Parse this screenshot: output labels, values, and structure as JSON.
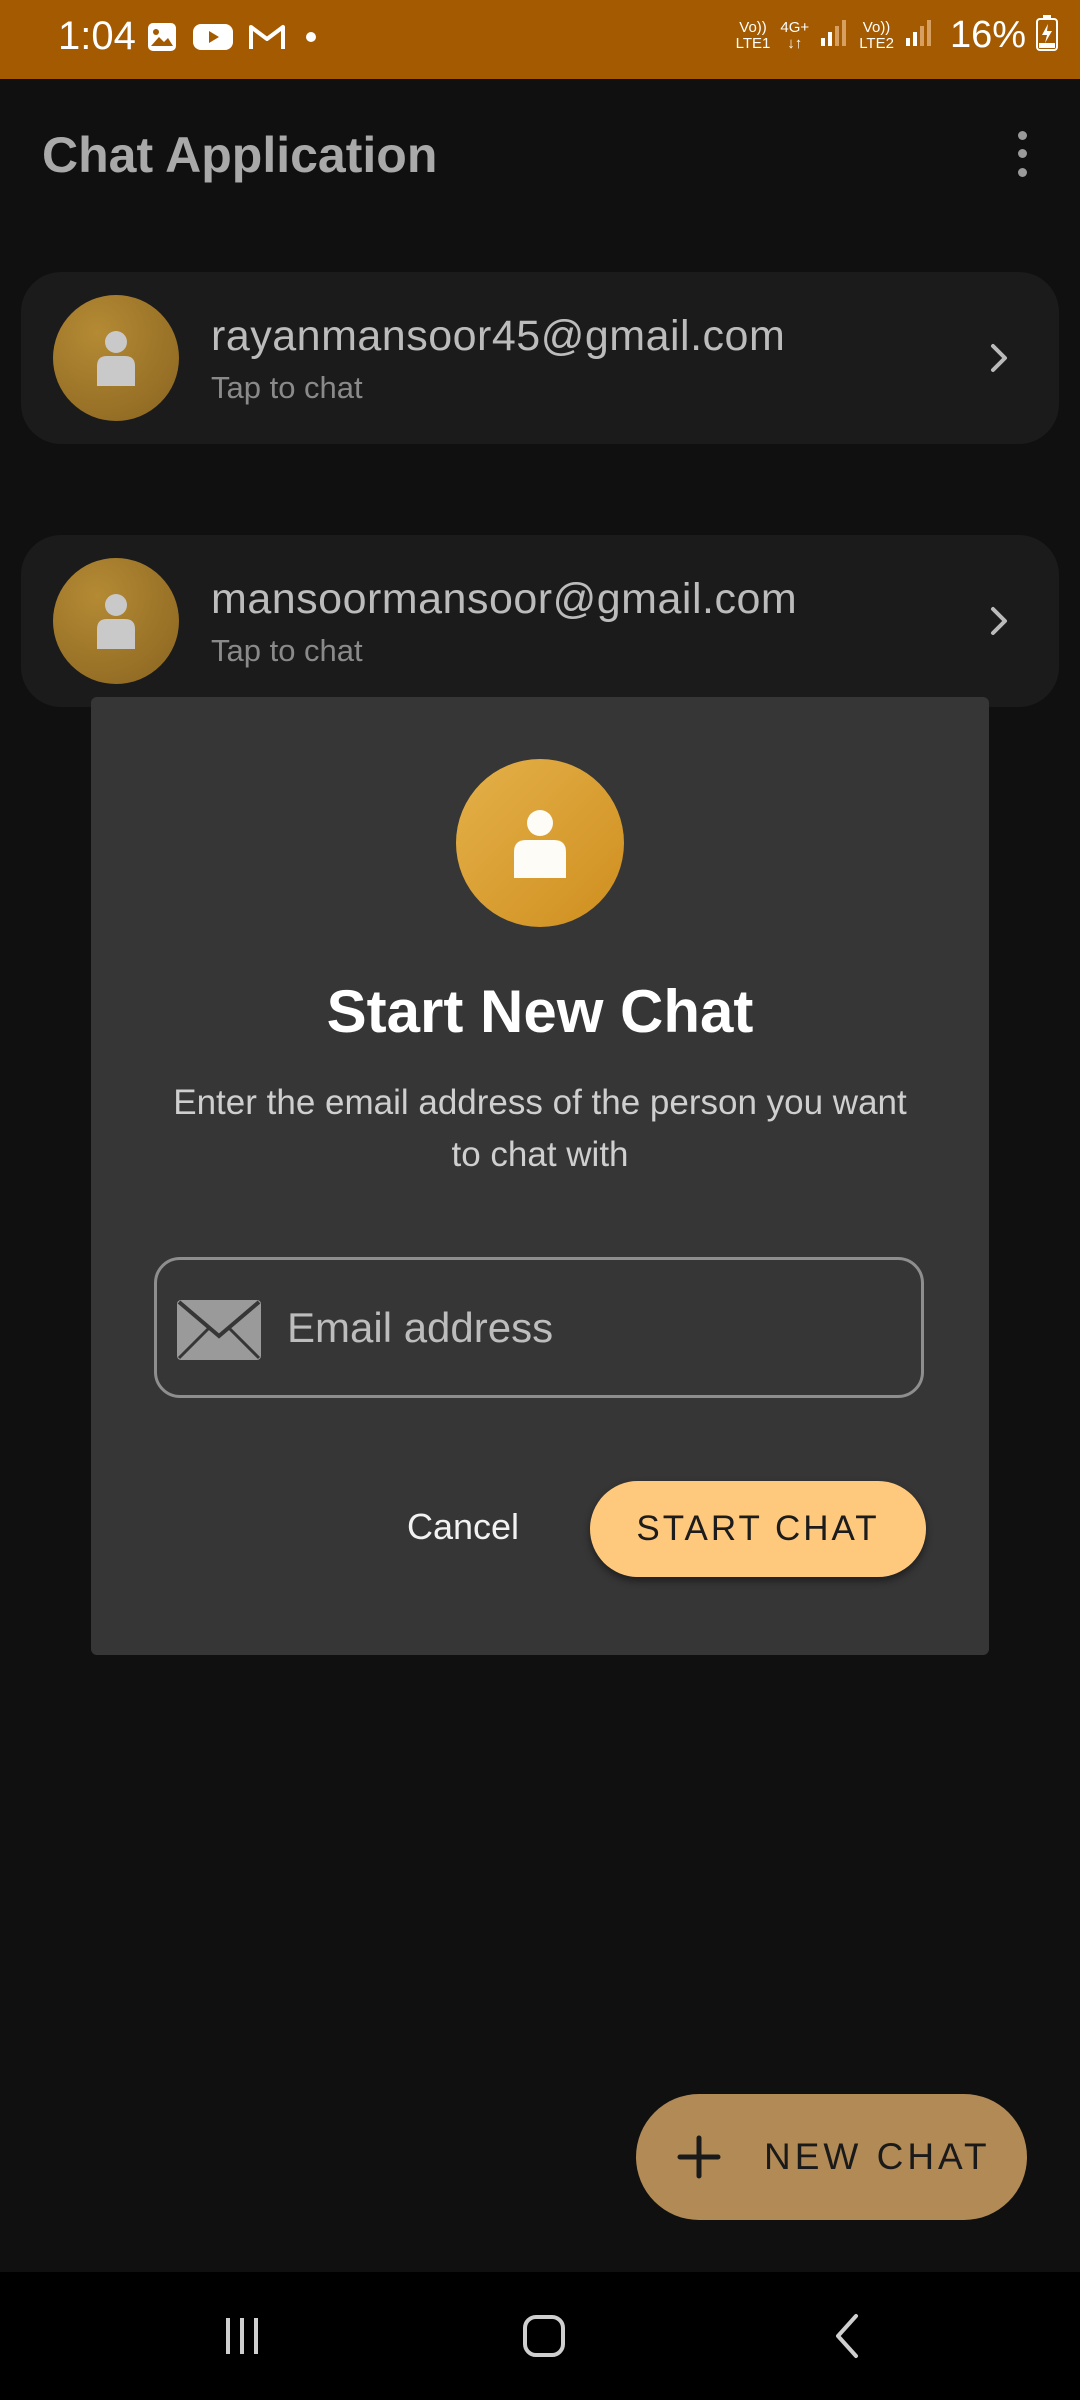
{
  "status_bar": {
    "time": "1:04",
    "sim1_label_top": "Vo))",
    "sim1_label_bottom": "LTE1",
    "network_top": "4G+",
    "network_bottom": "↓↑",
    "sim2_label_top": "Vo))",
    "sim2_label_bottom": "LTE2",
    "battery": "16%",
    "notification_icons": [
      "gallery-icon",
      "youtube-icon",
      "gmail-icon",
      "dot-icon"
    ]
  },
  "app_bar": {
    "title": "Chat Application"
  },
  "chats": [
    {
      "email": "rayanmansoor45@gmail.com",
      "subtitle": "Tap to chat"
    },
    {
      "email": "mansoormansoor@gmail.com",
      "subtitle": "Tap to chat"
    }
  ],
  "dialog": {
    "title": "Start New Chat",
    "description": "Enter the email address of the person you want to chat with",
    "email_placeholder": "Email address",
    "email_value": "",
    "cancel_label": "Cancel",
    "start_label": "START CHAT"
  },
  "fab": {
    "label": "NEW CHAT"
  },
  "colors": {
    "status_bar": "#a45a00",
    "accent": "#ffc97d",
    "fab": "#b18a55",
    "dialog_bg": "#363636",
    "background": "#101010"
  }
}
